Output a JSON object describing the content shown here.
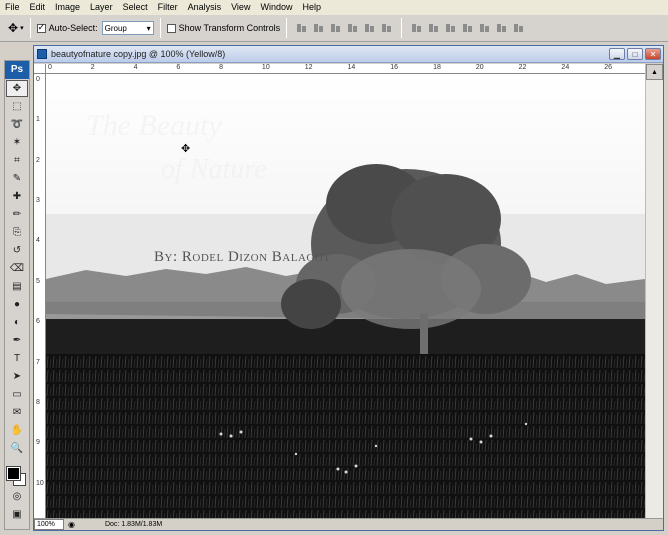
{
  "menu": [
    "File",
    "Edit",
    "Image",
    "Layer",
    "Select",
    "Filter",
    "Analysis",
    "View",
    "Window",
    "Help"
  ],
  "options": {
    "auto_select_label": "Auto-Select:",
    "auto_select_checked": true,
    "group_value": "Group",
    "show_transform_label": "Show Transform Controls",
    "show_transform_checked": false
  },
  "toolbox": {
    "logo": "Ps",
    "tools": [
      "move-icon",
      "marquee-icon",
      "lasso-icon",
      "magic-wand-icon",
      "crop-icon",
      "eyedropper-icon",
      "healing-brush-icon",
      "brush-icon",
      "clone-stamp-icon",
      "history-brush-icon",
      "eraser-icon",
      "gradient-icon",
      "blur-icon",
      "dodge-icon",
      "pen-icon",
      "type-icon",
      "path-selection-icon",
      "shape-icon",
      "notes-icon",
      "hand-icon",
      "zoom-icon"
    ],
    "tool_glyphs": [
      "✥",
      "⬚",
      "➰",
      "✶",
      "⌗",
      "✎",
      "✚",
      "✏",
      "⎘",
      "↺",
      "⌫",
      "▤",
      "●",
      "◐",
      "✒",
      "T",
      "➤",
      "▭",
      "✉",
      "✋",
      "🔍"
    ],
    "fg_color": "#000000",
    "bg_color": "#ffffff"
  },
  "document": {
    "title": "beautyofnature copy.jpg @ 100% (Yellow/8)",
    "ruler_h": [
      "0",
      "2",
      "4",
      "6",
      "8",
      "10",
      "12",
      "14",
      "16",
      "18",
      "20",
      "22",
      "24",
      "26"
    ],
    "ruler_v": [
      "0",
      "1",
      "2",
      "3",
      "4",
      "5",
      "6",
      "7",
      "8",
      "9",
      "10"
    ],
    "credit_text": "By: Rodel Dizon Balagot",
    "zoom": "100%",
    "doc_info": "Doc: 1.83M/1.83M"
  }
}
